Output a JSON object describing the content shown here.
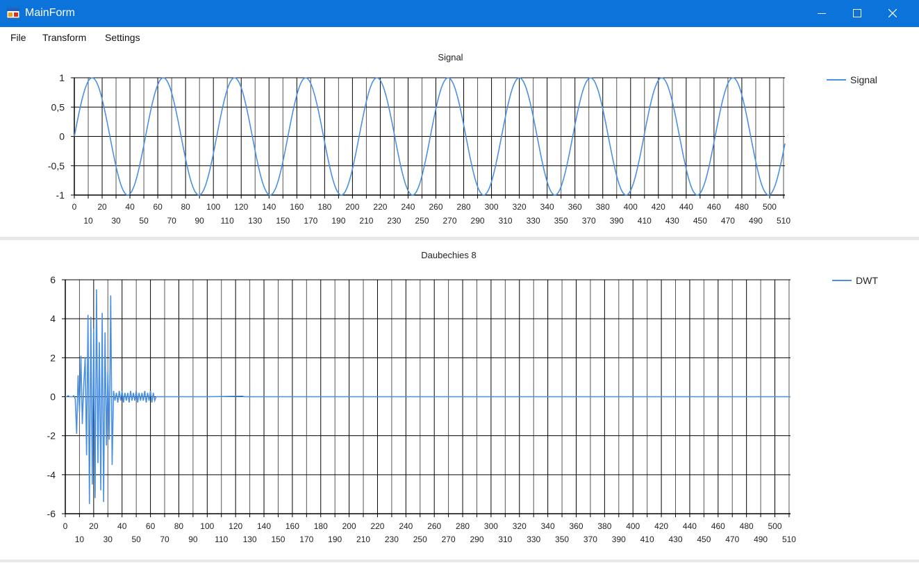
{
  "window": {
    "title": "MainForm",
    "accent_color": "#0b73d9",
    "icons": [
      "app-icon",
      "minimize-icon",
      "maximize-icon",
      "close-icon"
    ]
  },
  "menu": {
    "items": [
      {
        "label": "File"
      },
      {
        "label": "Transform"
      },
      {
        "label": "Settings"
      }
    ]
  },
  "chart_data": [
    {
      "type": "line",
      "title": "Signal",
      "series": [
        {
          "name": "Signal",
          "color": "#4a90e2",
          "function": "sin(2*pi*x/51.2)",
          "x_range": [
            0,
            511
          ],
          "samples": 512
        }
      ],
      "legend": {
        "position": "top-right",
        "entries": [
          "Signal"
        ]
      },
      "xlim": [
        0,
        511
      ],
      "ylim": [
        -1,
        1
      ],
      "x_ticks": [
        0,
        10,
        20,
        30,
        40,
        50,
        60,
        70,
        80,
        90,
        100,
        110,
        120,
        130,
        140,
        150,
        160,
        170,
        180,
        190,
        200,
        210,
        220,
        230,
        240,
        250,
        260,
        270,
        280,
        290,
        300,
        310,
        320,
        330,
        340,
        350,
        360,
        370,
        380,
        390,
        400,
        410,
        420,
        430,
        440,
        450,
        460,
        470,
        480,
        490,
        500,
        510
      ],
      "y_ticks": [
        1,
        0.5,
        0,
        -0.5,
        -1
      ],
      "y_tick_labels": [
        "1",
        "0,5",
        "0",
        "-0,5",
        "-1"
      ],
      "grid": true
    },
    {
      "type": "line",
      "title": "Daubechies 8",
      "series": [
        {
          "name": "DWT",
          "color": "#4a90e2",
          "points": [
            [
              0,
              0
            ],
            [
              1,
              0
            ],
            [
              2,
              0.05
            ],
            [
              3,
              0
            ],
            [
              4,
              0
            ],
            [
              5,
              0
            ],
            [
              6,
              0.05
            ],
            [
              7,
              -0.1
            ],
            [
              8,
              -1.9
            ],
            [
              9,
              1.1
            ],
            [
              10,
              -0.8
            ],
            [
              11,
              2.1
            ],
            [
              12,
              -1.4
            ],
            [
              13,
              0.6
            ],
            [
              14,
              2.0
            ],
            [
              15,
              -3.0
            ],
            [
              16,
              4.2
            ],
            [
              17,
              -5.5
            ],
            [
              18,
              4.1
            ],
            [
              19,
              -4.5
            ],
            [
              20,
              3.5
            ],
            [
              21,
              -5.2
            ],
            [
              22,
              5.5
            ],
            [
              23,
              -3.4
            ],
            [
              24,
              2.8
            ],
            [
              25,
              -4.8
            ],
            [
              26,
              4.3
            ],
            [
              27,
              -5.4
            ],
            [
              28,
              3.3
            ],
            [
              29,
              -2.5
            ],
            [
              30,
              1.3
            ],
            [
              31,
              -2.2
            ],
            [
              32,
              5.2
            ],
            [
              33,
              -3.5
            ],
            [
              34,
              0.3
            ],
            [
              35,
              -0.2
            ],
            [
              36,
              0.2
            ],
            [
              37,
              -0.3
            ],
            [
              38,
              0.3
            ],
            [
              39,
              -0.2
            ],
            [
              40,
              0.3
            ],
            [
              41,
              -0.3
            ],
            [
              42,
              0.2
            ],
            [
              43,
              -0.2
            ],
            [
              44,
              0.2
            ],
            [
              45,
              -0.3
            ],
            [
              46,
              0.3
            ],
            [
              47,
              -0.2
            ],
            [
              48,
              0.2
            ],
            [
              49,
              -0.2
            ],
            [
              50,
              0.3
            ],
            [
              51,
              -0.3
            ],
            [
              52,
              0.2
            ],
            [
              53,
              -0.2
            ],
            [
              54,
              0.2
            ],
            [
              55,
              -0.2
            ],
            [
              56,
              0.3
            ],
            [
              57,
              -0.3
            ],
            [
              58,
              0.2
            ],
            [
              59,
              -0.2
            ],
            [
              60,
              0.3
            ],
            [
              61,
              -0.3
            ],
            [
              62,
              0.2
            ],
            [
              63,
              -0.2
            ],
            [
              64,
              0
            ],
            [
              100,
              0
            ],
            [
              125,
              0.03
            ],
            [
              126,
              0
            ],
            [
              200,
              0
            ],
            [
              256,
              0
            ],
            [
              350,
              0
            ],
            [
              511,
              0
            ]
          ]
        }
      ],
      "legend": {
        "position": "top-right",
        "entries": [
          "DWT"
        ]
      },
      "xlim": [
        0,
        511
      ],
      "ylim": [
        -6,
        6
      ],
      "x_ticks": [
        0,
        10,
        20,
        30,
        40,
        50,
        60,
        70,
        80,
        90,
        100,
        110,
        120,
        130,
        140,
        150,
        160,
        170,
        180,
        190,
        200,
        210,
        220,
        230,
        240,
        250,
        260,
        270,
        280,
        290,
        300,
        310,
        320,
        330,
        340,
        350,
        360,
        370,
        380,
        390,
        400,
        410,
        420,
        430,
        440,
        450,
        460,
        470,
        480,
        490,
        500,
        510
      ],
      "y_ticks": [
        6,
        4,
        2,
        0,
        -2,
        -4,
        -6
      ],
      "y_tick_labels": [
        "6",
        "4",
        "2",
        "0",
        "-2",
        "-4",
        "-6"
      ],
      "grid": true
    }
  ]
}
